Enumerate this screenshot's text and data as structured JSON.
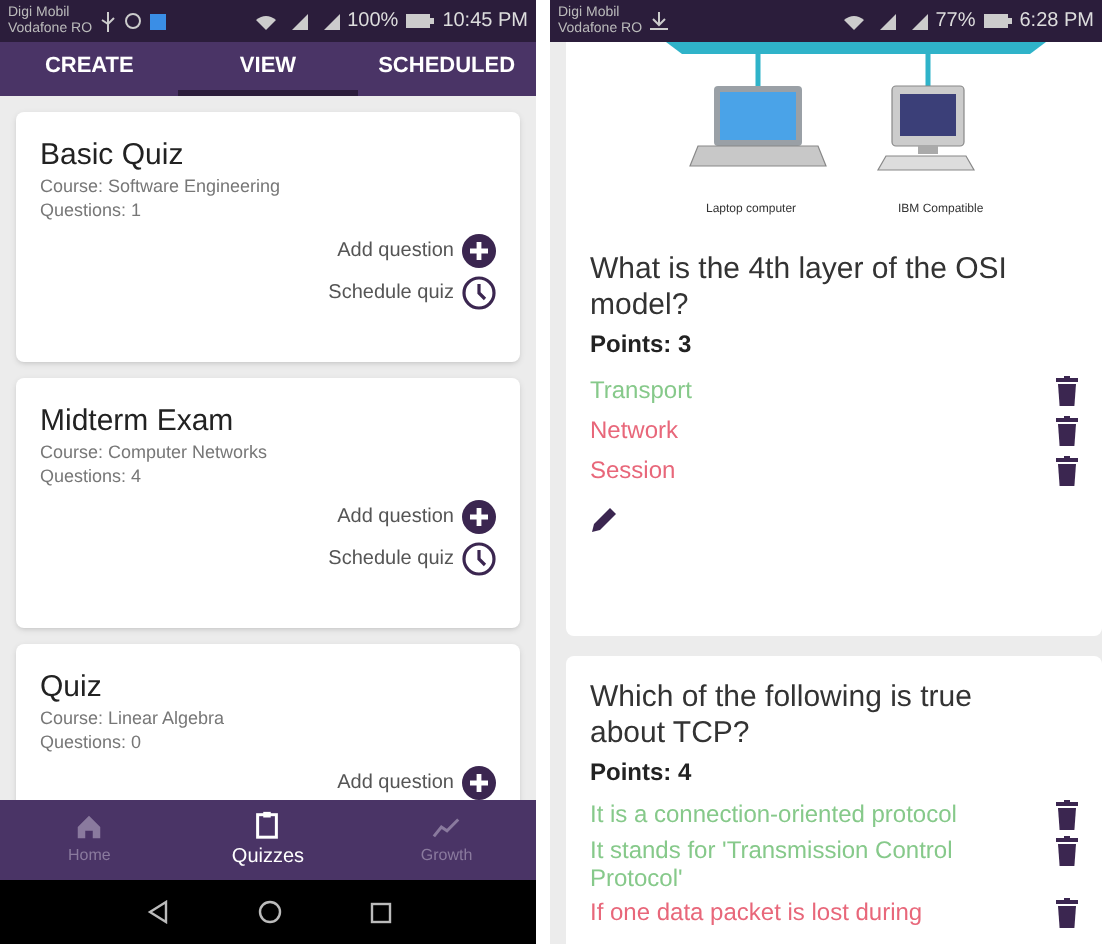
{
  "left_phone": {
    "status_bar": {
      "carrier_1": "Digi Mobil",
      "carrier_2": "Vodafone RO",
      "battery": "100%",
      "time": "10:45 PM"
    },
    "tabs": [
      {
        "label": "CREATE",
        "selected": false
      },
      {
        "label": "VIEW",
        "selected": true
      },
      {
        "label": "SCHEDULED",
        "selected": false
      }
    ],
    "quizzes": [
      {
        "title": "Basic Quiz",
        "course": "Course: Software Engineering",
        "questions": "Questions: 1",
        "add_label": "Add question",
        "schedule_label": "Schedule quiz"
      },
      {
        "title": "Midterm Exam",
        "course": "Course: Computer Networks",
        "questions": "Questions: 4",
        "add_label": "Add question",
        "schedule_label": "Schedule quiz"
      },
      {
        "title": "Quiz",
        "course": "Course: Linear Algebra",
        "questions": "Questions: 0",
        "add_label": "Add question"
      }
    ],
    "bottom_nav": [
      {
        "label": "Home",
        "kind": "home",
        "selected": false
      },
      {
        "label": "Quizzes",
        "kind": "clipboard",
        "selected": true
      },
      {
        "label": "Growth",
        "kind": "trend",
        "selected": false
      }
    ]
  },
  "right_phone": {
    "status_bar": {
      "carrier_1": "Digi Mobil",
      "carrier_2": "Vodafone RO",
      "battery": "77%",
      "time": "6:28 PM"
    },
    "diagram_labels": [
      "Laptop computer",
      "IBM Compatible"
    ],
    "questions": [
      {
        "text": "What is the 4th layer of the OSI model?",
        "points": "Points: 3",
        "answers": [
          {
            "text": "Transport",
            "correct": true
          },
          {
            "text": "Network",
            "correct": false
          },
          {
            "text": "Session",
            "correct": false
          }
        ]
      },
      {
        "text": "Which of the following is true about TCP?",
        "points": "Points: 4",
        "answers": [
          {
            "text": "It is a connection-oriented protocol",
            "correct": true
          },
          {
            "text": "It stands for 'Transmission Control Protocol'",
            "correct": true
          },
          {
            "text": "If one data packet is lost during",
            "correct": false
          }
        ]
      }
    ]
  }
}
